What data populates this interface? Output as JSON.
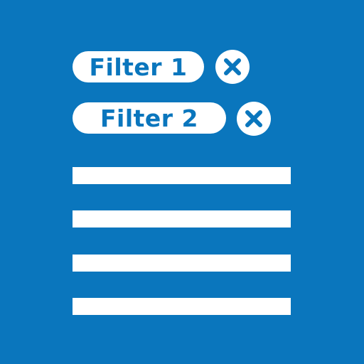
{
  "filters": [
    {
      "label": "Filter 1",
      "remove_icon": "close-x-icon"
    },
    {
      "label": "Filter 2",
      "remove_icon": "close-x-icon"
    }
  ],
  "list": {
    "row_count": 4
  },
  "colors": {
    "background": "#0a76bd",
    "foreground": "#ffffff"
  }
}
